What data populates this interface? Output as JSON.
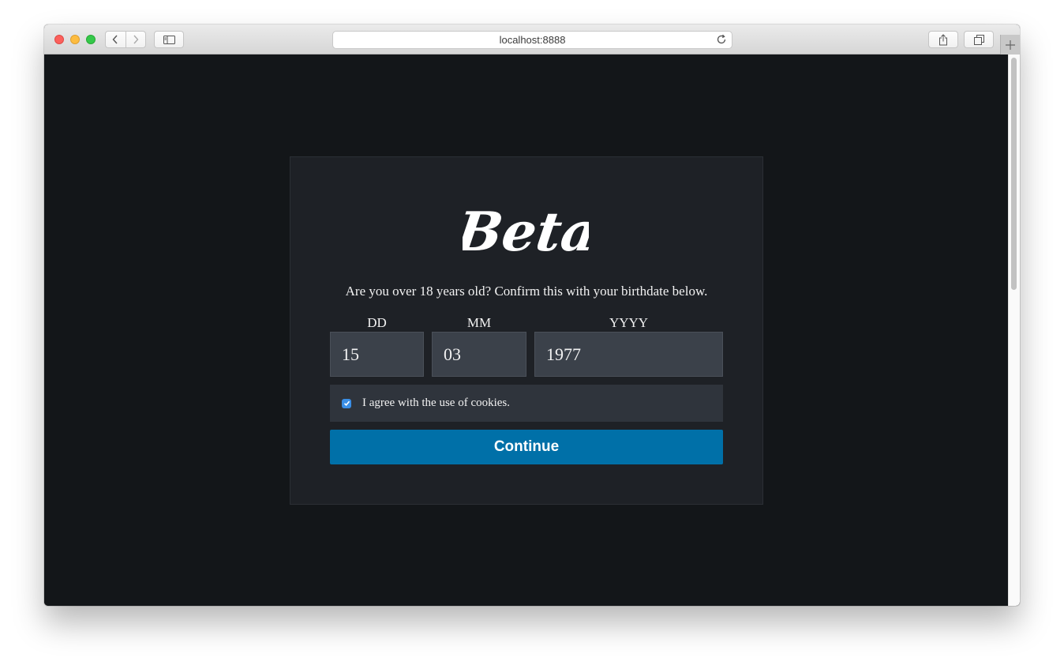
{
  "browser": {
    "url": "localhost:8888",
    "icons": [
      "back-icon",
      "forward-icon",
      "sidebar-icon",
      "reload-icon",
      "share-icon",
      "tabs-icon",
      "plus-icon"
    ]
  },
  "age_gate": {
    "logo_text": "Beta",
    "prompt": "Are you over 18 years old? Confirm this with your birthdate below.",
    "fields": {
      "day": {
        "label": "DD",
        "value": "15"
      },
      "month": {
        "label": "MM",
        "value": "03"
      },
      "year": {
        "label": "YYYY",
        "value": "1977"
      }
    },
    "cookie_consent": {
      "label": "I agree with the use of cookies.",
      "checked": true
    },
    "continue_label": "Continue"
  },
  "colors": {
    "page_background": "#131619",
    "card_background": "#1e2126",
    "input_background": "#3b414a",
    "cookie_row_background": "#2f343c",
    "button_color": "#0070a8",
    "checkbox_color": "#3a8ee6"
  }
}
